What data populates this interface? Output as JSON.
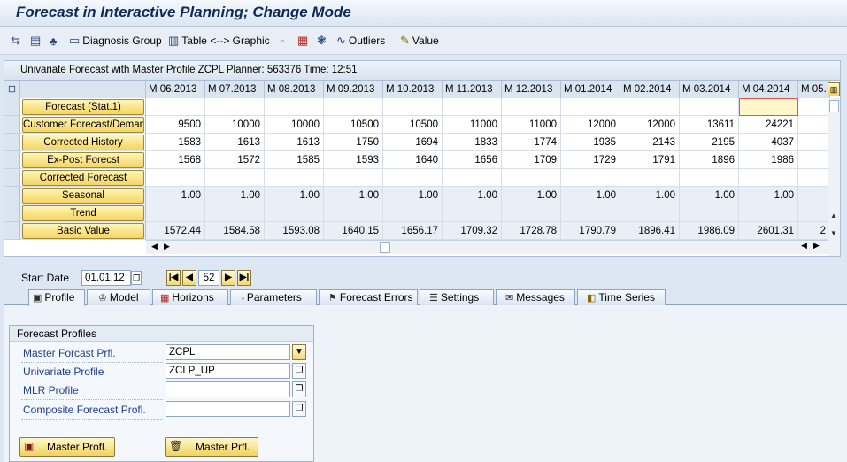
{
  "window": {
    "title": "Forecast in Interactive Planning; Change Mode"
  },
  "toolbar": {
    "items": [
      {
        "label": "",
        "icon": "back-forward-icon"
      },
      {
        "label": "",
        "icon": "chart-icon"
      },
      {
        "label": "",
        "icon": "hierarchy-icon"
      },
      {
        "label": "Diagnosis Group",
        "icon": "diagnosis-icon"
      },
      {
        "label": "Table <--> Graphic",
        "icon": "table-graphic-icon"
      },
      {
        "label": "",
        "icon": "small-square-icon"
      },
      {
        "label": "",
        "icon": "calculator-icon"
      },
      {
        "label": "",
        "icon": "parameters-icon"
      },
      {
        "label": "Outliers",
        "icon": "outliers-icon"
      },
      {
        "label": "Value",
        "icon": "pencil-icon"
      }
    ]
  },
  "grid": {
    "title": "Univariate Forecast with Master Profile ZCPL Planner: 563376 Time: 12:51",
    "columns": [
      "M 06.2013",
      "M 07.2013",
      "M 08.2013",
      "M 09.2013",
      "M 10.2013",
      "M 11.2013",
      "M 12.2013",
      "M 01.2014",
      "M 02.2014",
      "M 03.2014",
      "M 04.2014",
      "M 05."
    ],
    "rows": [
      {
        "label": "Forecast (Stat.1)",
        "values": [
          "",
          "",
          "",
          "",
          "",
          "",
          "",
          "",
          "",
          "",
          "",
          ""
        ]
      },
      {
        "label": "Customer Forecast/Demand",
        "values": [
          "9500",
          "10000",
          "10000",
          "10500",
          "10500",
          "11000",
          "11000",
          "12000",
          "12000",
          "13611",
          "24221",
          ""
        ]
      },
      {
        "label": "Corrected History",
        "values": [
          "1583",
          "1613",
          "1613",
          "1750",
          "1694",
          "1833",
          "1774",
          "1935",
          "2143",
          "2195",
          "4037",
          ""
        ]
      },
      {
        "label": "Ex-Post Forecst",
        "values": [
          "1568",
          "1572",
          "1585",
          "1593",
          "1640",
          "1656",
          "1709",
          "1729",
          "1791",
          "1896",
          "1986",
          ""
        ]
      },
      {
        "label": "Corrected Forecast",
        "values": [
          "",
          "",
          "",
          "",
          "",
          "",
          "",
          "",
          "",
          "",
          "",
          ""
        ]
      },
      {
        "label": "Seasonal",
        "values": [
          "1.00",
          "1.00",
          "1.00",
          "1.00",
          "1.00",
          "1.00",
          "1.00",
          "1.00",
          "1.00",
          "1.00",
          "1.00",
          ""
        ]
      },
      {
        "label": "Trend",
        "values": [
          "",
          "",
          "",
          "",
          "",
          "",
          "",
          "",
          "",
          "",
          "",
          ""
        ]
      },
      {
        "label": "Basic Value",
        "values": [
          "1572.44",
          "1584.58",
          "1593.08",
          "1640.15",
          "1656.17",
          "1709.32",
          "1728.78",
          "1790.79",
          "1896.41",
          "1986.09",
          "2601.31",
          "2"
        ]
      }
    ]
  },
  "period": {
    "start_date_label": "Start Date",
    "start_date_value": "01.01.12",
    "periods_value": "52"
  },
  "tabs": [
    {
      "label": "Profile",
      "icon": "profile-icon",
      "active": true
    },
    {
      "label": "Model",
      "icon": "model-icon",
      "active": false
    },
    {
      "label": "Horizons",
      "icon": "calendar-icon",
      "active": false
    },
    {
      "label": "Parameters",
      "icon": "small-square-icon",
      "active": false
    },
    {
      "label": "Forecast Errors",
      "icon": "errors-icon",
      "active": false
    },
    {
      "label": "Settings",
      "icon": "settings-icon",
      "active": false
    },
    {
      "label": "Messages",
      "icon": "messages-icon",
      "active": false
    },
    {
      "label": "Time Series",
      "icon": "time-series-icon",
      "active": false
    }
  ],
  "profiles": {
    "title": "Forecast Profiles",
    "fields": [
      {
        "label": "Master Forcast Prfl.",
        "value": "ZCPL"
      },
      {
        "label": "Univariate Profile",
        "value": "ZCLP_UP"
      },
      {
        "label": "MLR Profile",
        "value": ""
      },
      {
        "label": "Composite Forecast Profl.",
        "value": ""
      }
    ],
    "save_button": "Master Profl.",
    "delete_button": "Master Prfl."
  },
  "colors": {
    "title_text": "#0c2a57",
    "row_button": "#f5d563",
    "field_label": "#1d3f8a"
  }
}
